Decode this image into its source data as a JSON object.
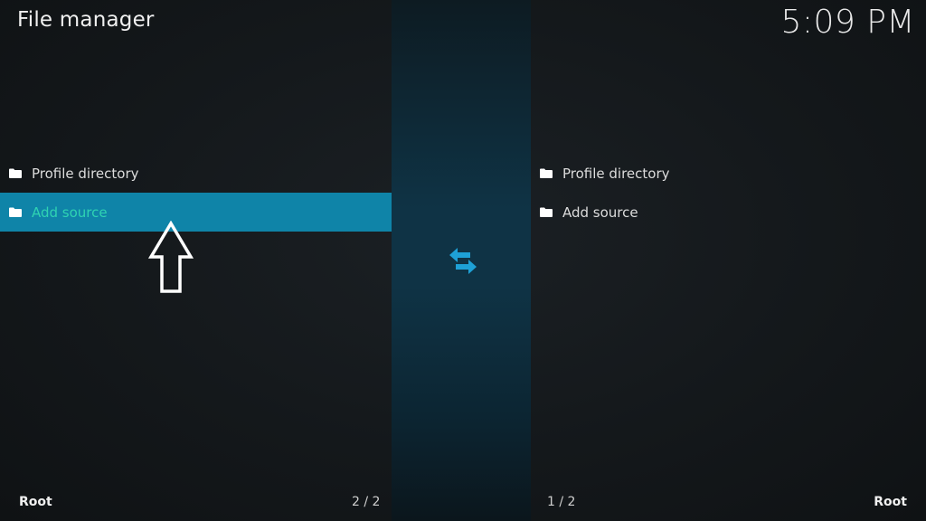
{
  "header": {
    "title": "File manager",
    "clock": "5:09 PM"
  },
  "left_pane": {
    "items": [
      {
        "label": "Profile directory",
        "icon": "folder-icon",
        "selected": false
      },
      {
        "label": "Add source",
        "icon": "folder-icon",
        "selected": true
      }
    ],
    "footer_location": "Root",
    "footer_count": "2 / 2"
  },
  "right_pane": {
    "items": [
      {
        "label": "Profile directory",
        "icon": "folder-icon",
        "selected": false
      },
      {
        "label": "Add source",
        "icon": "folder-icon",
        "selected": false
      }
    ],
    "footer_location": "Root",
    "footer_count": "1 / 2"
  },
  "center": {
    "icon": "swap-arrows-icon"
  },
  "annotation": {
    "icon": "up-arrow-outline-icon"
  },
  "colors": {
    "selection_bg": "#0f84a8",
    "selection_text": "#2fd3b2",
    "swap_icon": "#1ea1d6",
    "center_strip": "#0f3345"
  }
}
